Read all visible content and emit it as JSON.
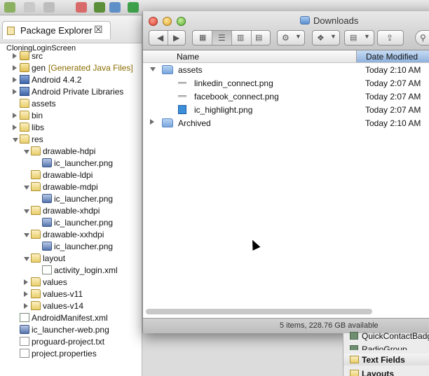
{
  "explorer": {
    "tab_label": "Package Explorer",
    "tab_close": "☒",
    "project": "CloningLoginScreen",
    "tree": [
      {
        "label": "src",
        "suffix": "",
        "icon": "package-icon",
        "twisty": "right"
      },
      {
        "label": "gen",
        "suffix": "[Generated Java Files]",
        "icon": "package-icon",
        "twisty": "right"
      },
      {
        "label": "Android 4.4.2",
        "suffix": "",
        "icon": "library-icon",
        "twisty": "right"
      },
      {
        "label": "Android Private Libraries",
        "suffix": "",
        "icon": "library-icon",
        "twisty": "right"
      },
      {
        "label": "assets",
        "suffix": "",
        "icon": "folder-icon",
        "twisty": ""
      },
      {
        "label": "bin",
        "suffix": "",
        "icon": "folder-icon",
        "twisty": "right"
      },
      {
        "label": "libs",
        "suffix": "",
        "icon": "folder-icon",
        "twisty": "right"
      },
      {
        "label": "res",
        "suffix": "",
        "icon": "folder-icon",
        "twisty": "down"
      },
      {
        "label": "drawable-hdpi",
        "suffix": "",
        "icon": "folder-icon",
        "twisty": "down"
      },
      {
        "label": "ic_launcher.png",
        "suffix": "",
        "icon": "image-file-icon",
        "twisty": ""
      },
      {
        "label": "drawable-ldpi",
        "suffix": "",
        "icon": "folder-icon",
        "twisty": ""
      },
      {
        "label": "drawable-mdpi",
        "suffix": "",
        "icon": "folder-icon",
        "twisty": "down"
      },
      {
        "label": "ic_launcher.png",
        "suffix": "",
        "icon": "image-file-icon",
        "twisty": ""
      },
      {
        "label": "drawable-xhdpi",
        "suffix": "",
        "icon": "folder-icon",
        "twisty": "down"
      },
      {
        "label": "ic_launcher.png",
        "suffix": "",
        "icon": "image-file-icon",
        "twisty": ""
      },
      {
        "label": "drawable-xxhdpi",
        "suffix": "",
        "icon": "folder-icon",
        "twisty": "down"
      },
      {
        "label": "ic_launcher.png",
        "suffix": "",
        "icon": "image-file-icon",
        "twisty": ""
      },
      {
        "label": "layout",
        "suffix": "",
        "icon": "folder-icon",
        "twisty": "down"
      },
      {
        "label": "activity_login.xml",
        "suffix": "",
        "icon": "xml-file-icon",
        "twisty": ""
      },
      {
        "label": "values",
        "suffix": "",
        "icon": "folder-icon",
        "twisty": "right"
      },
      {
        "label": "values-v11",
        "suffix": "",
        "icon": "folder-icon",
        "twisty": "right"
      },
      {
        "label": "values-v14",
        "suffix": "",
        "icon": "folder-icon",
        "twisty": "right"
      },
      {
        "label": "AndroidManifest.xml",
        "suffix": "",
        "icon": "xml-file-icon",
        "twisty": ""
      },
      {
        "label": "ic_launcher-web.png",
        "suffix": "",
        "icon": "image-file-icon",
        "twisty": ""
      },
      {
        "label": "proguard-project.txt",
        "suffix": "",
        "icon": "text-file-icon",
        "twisty": ""
      },
      {
        "label": "project.properties",
        "suffix": "",
        "icon": "text-file-icon",
        "twisty": ""
      }
    ]
  },
  "finder": {
    "title": "Downloads",
    "columns": {
      "name": "Name",
      "date": "Date Modified"
    },
    "rows": [
      {
        "name": "assets",
        "date": "Today 2:10 AM",
        "kind": "folder",
        "twisty": "down"
      },
      {
        "name": "linkedin_connect.png",
        "date": "Today 2:07 AM",
        "kind": "doc",
        "twisty": ""
      },
      {
        "name": "facebook_connect.png",
        "date": "Today 2:07 AM",
        "kind": "doc",
        "twisty": ""
      },
      {
        "name": "ic_highlight.png",
        "date": "Today 2:07 AM",
        "kind": "image",
        "twisty": ""
      },
      {
        "name": "Archived",
        "date": "Today 2:10 AM",
        "kind": "folder",
        "twisty": "right"
      }
    ],
    "status": "5 items, 228.76 GB available"
  },
  "palette": {
    "items": [
      "QuickContactBadge",
      "RadioGroup",
      "Text Fields",
      "Layouts"
    ]
  },
  "colors": {
    "finder_selected_header": "#9dbde5",
    "suffix": "#8a6d00"
  }
}
